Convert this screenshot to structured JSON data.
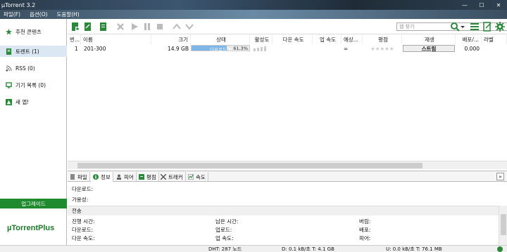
{
  "window": {
    "title": "µTorrent 3.2"
  },
  "menu": [
    "파일(F)",
    "옵션(O)",
    "도움말(H)"
  ],
  "sidebar": {
    "items": [
      {
        "label": "추천 콘텐츠",
        "icon": "star-icon"
      },
      {
        "label": "토렌트 (1)",
        "icon": "torrent-icon"
      },
      {
        "label": "RSS (0)",
        "icon": "rss-icon"
      },
      {
        "label": "기기 목록 (0)",
        "icon": "device-icon"
      },
      {
        "label": "새 앱!",
        "icon": "app-icon"
      }
    ],
    "upgrade_label": "업그레이드",
    "plus_logo": "µTorrentPlus"
  },
  "toolbar": {
    "search_placeholder": "웹 찾기"
  },
  "list": {
    "columns": [
      "번...",
      "이름",
      "크기",
      "상태",
      "활성도",
      "다운 속도",
      "업 속도",
      "예상...",
      "평점",
      "재생",
      "배포/...",
      "라벨"
    ],
    "rows": [
      {
        "num": "1",
        "name": "201-300",
        "size": "14.9 GB",
        "status": "다운로드 중",
        "progress": 61.3,
        "progress_text": "61.3%",
        "eta": "∞",
        "rating": "★★★★★",
        "play": "스트림",
        "ratio": "0.000"
      }
    ]
  },
  "tabs": [
    {
      "label": "파일",
      "icon": "file-icon"
    },
    {
      "label": "정보",
      "icon": "info-icon"
    },
    {
      "label": "피어",
      "icon": "peers-icon"
    },
    {
      "label": "평점",
      "icon": "rating-icon"
    },
    {
      "label": "트래커",
      "icon": "tracker-icon"
    },
    {
      "label": "속도",
      "icon": "speed-icon"
    }
  ],
  "detail": {
    "downloaded_label": "다운로드:",
    "availability_label": "가용성:",
    "transfer_section": "전송",
    "fields": {
      "elapsed": "진행 시간:",
      "remaining": "남은 시간:",
      "wasted": "버림:",
      "downloaded": "다운로드:",
      "uploaded": "업로드:",
      "seeds": "배포:",
      "down_speed": "다운 속도:",
      "up_speed": "업 속도:",
      "peers": "피어:"
    }
  },
  "status": {
    "dht": "DHT: 287 노드",
    "down": "D: 0.1 kB/초 T: 4.1 GB",
    "up": "U: 0.0 kB/초 T: 76.1 MB"
  }
}
